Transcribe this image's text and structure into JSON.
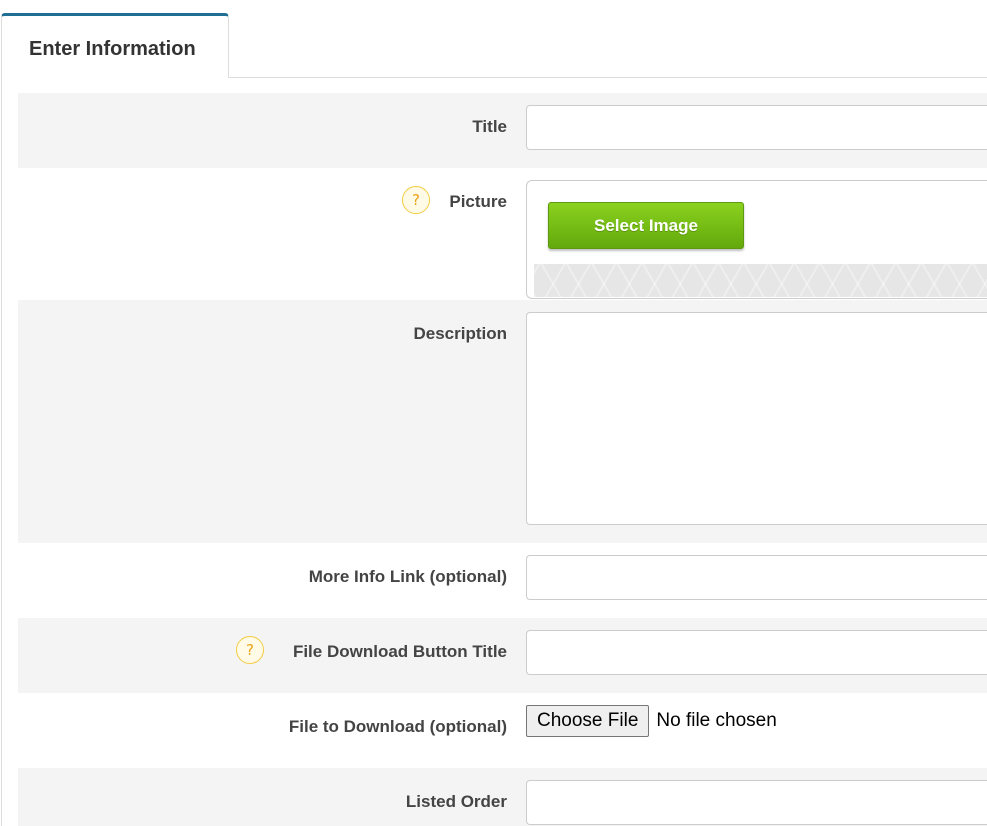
{
  "tab": {
    "label": "Enter Information"
  },
  "fields": {
    "title": {
      "label": "Title",
      "value": ""
    },
    "picture": {
      "label": "Picture",
      "help_icon": "question-mark-icon",
      "button_label": "Select Image"
    },
    "description": {
      "label": "Description",
      "value": ""
    },
    "more_info_link": {
      "label": "More Info Link (optional)",
      "value": ""
    },
    "file_download_button_title": {
      "label": "File Download Button Title",
      "help_icon": "question-mark-icon",
      "value": ""
    },
    "file_to_download": {
      "label": "File to Download (optional)",
      "button_label": "Choose File",
      "status": "No file chosen"
    },
    "listed_order": {
      "label": "Listed Order",
      "value": ""
    }
  },
  "help_glyph": "?",
  "colors": {
    "tab_accent": "#1f6f95",
    "row_shade": "#f4f4f4",
    "button_green": "#6db313",
    "help_yellow": "#f2cc44"
  }
}
